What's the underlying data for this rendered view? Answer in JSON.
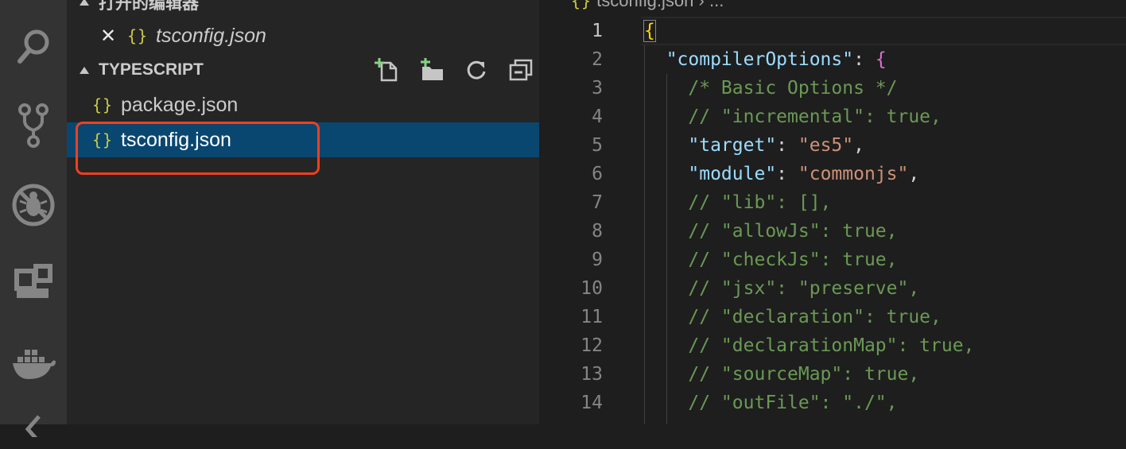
{
  "activity_bar": {
    "icons": [
      "search-icon",
      "source-control-icon",
      "debug-icon",
      "extensions-icon",
      "docker-icon"
    ]
  },
  "sidebar": {
    "open_editors": {
      "title": "打开的编辑器",
      "items": [
        {
          "name": "tsconfig.json",
          "icon": "json-braces-icon",
          "italic": true
        }
      ]
    },
    "workspace": {
      "title": "TYPESCRIPT",
      "actions": [
        "new-file-icon",
        "new-folder-icon",
        "refresh-icon",
        "collapse-all-icon"
      ],
      "files": [
        {
          "name": "package.json",
          "icon": "json-braces-icon",
          "selected": false
        },
        {
          "name": "tsconfig.json",
          "icon": "json-braces-icon",
          "selected": true
        }
      ]
    },
    "annotation_color": "#f0401d",
    "selection_color": "#094771"
  },
  "editor": {
    "breadcrumb": {
      "file": "tsconfig.json",
      "separator": "›",
      "more": "..."
    },
    "active_line": 1,
    "lines": [
      {
        "num": "1",
        "tokens": [
          {
            "t": "{",
            "c": "brace1"
          }
        ]
      },
      {
        "num": "2",
        "tokens": [
          {
            "t": "  \"compilerOptions\"",
            "c": "key"
          },
          {
            "t": ": ",
            "c": "punc"
          },
          {
            "t": "{",
            "c": "brace2"
          }
        ]
      },
      {
        "num": "3",
        "tokens": [
          {
            "t": "    /* Basic Options */",
            "c": "cmt"
          }
        ]
      },
      {
        "num": "4",
        "tokens": [
          {
            "t": "    // \"incremental\": true,",
            "c": "cmt"
          }
        ]
      },
      {
        "num": "5",
        "tokens": [
          {
            "t": "    \"target\"",
            "c": "key"
          },
          {
            "t": ": ",
            "c": "punc"
          },
          {
            "t": "\"es5\"",
            "c": "str"
          },
          {
            "t": ",",
            "c": "punc"
          }
        ]
      },
      {
        "num": "6",
        "tokens": [
          {
            "t": "    \"module\"",
            "c": "key"
          },
          {
            "t": ": ",
            "c": "punc"
          },
          {
            "t": "\"commonjs\"",
            "c": "str"
          },
          {
            "t": ",",
            "c": "punc"
          }
        ]
      },
      {
        "num": "7",
        "tokens": [
          {
            "t": "    // \"lib\": [],",
            "c": "cmt"
          }
        ]
      },
      {
        "num": "8",
        "tokens": [
          {
            "t": "    // \"allowJs\": true,",
            "c": "cmt"
          }
        ]
      },
      {
        "num": "9",
        "tokens": [
          {
            "t": "    // \"checkJs\": true,",
            "c": "cmt"
          }
        ]
      },
      {
        "num": "10",
        "tokens": [
          {
            "t": "    // \"jsx\": \"preserve\",",
            "c": "cmt"
          }
        ]
      },
      {
        "num": "11",
        "tokens": [
          {
            "t": "    // \"declaration\": true,",
            "c": "cmt"
          }
        ]
      },
      {
        "num": "12",
        "tokens": [
          {
            "t": "    // \"declarationMap\": true,",
            "c": "cmt"
          }
        ]
      },
      {
        "num": "13",
        "tokens": [
          {
            "t": "    // \"sourceMap\": true,",
            "c": "cmt"
          }
        ]
      },
      {
        "num": "14",
        "tokens": [
          {
            "t": "    // \"outFile\": \"./\",",
            "c": "cmt"
          }
        ]
      }
    ]
  }
}
